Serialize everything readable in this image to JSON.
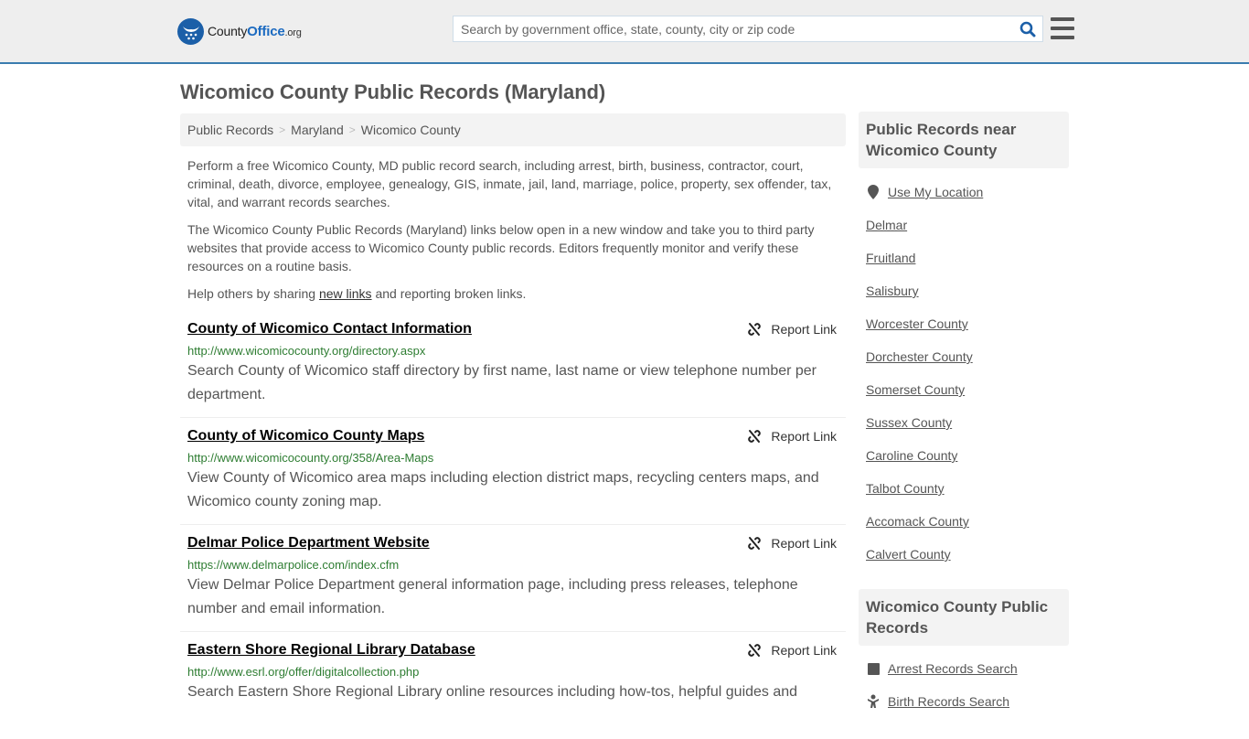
{
  "header": {
    "logo": {
      "name": "County",
      "highlight": "Office",
      "tld": ".org"
    },
    "search": {
      "placeholder": "Search by government office, state, county, city or zip code",
      "value": ""
    },
    "colors": {
      "brand": "#1b5fa8",
      "accent_bar": "#3a7caf"
    }
  },
  "page": {
    "title": "Wicomico County Public Records (Maryland)",
    "breadcrumb": [
      "Public Records",
      "Maryland",
      "Wicomico County"
    ],
    "intro": {
      "p1": "Perform a free Wicomico County, MD public record search, including arrest, birth, business, contractor, court, criminal, death, divorce, employee, genealogy, GIS, inmate, jail, land, marriage, police, property, sex offender, tax, vital, and warrant records searches.",
      "p2": "The Wicomico County Public Records (Maryland) links below open in a new window and take you to third party websites that provide access to Wicomico County public records. Editors frequently monitor and verify these resources on a routine basis.",
      "p3_before": "Help others by sharing ",
      "p3_link": "new links",
      "p3_after": " and reporting broken links."
    },
    "report_label": "Report Link",
    "records": [
      {
        "title": "County of Wicomico Contact Information",
        "url": "http://www.wicomicocounty.org/directory.aspx",
        "desc": "Search County of Wicomico staff directory by first name, last name or view telephone number per department."
      },
      {
        "title": "County of Wicomico County Maps",
        "url": "http://www.wicomicocounty.org/358/Area-Maps",
        "desc": "View County of Wicomico area maps including election district maps, recycling centers maps, and Wicomico county zoning map."
      },
      {
        "title": "Delmar Police Department Website",
        "url": "https://www.delmarpolice.com/index.cfm",
        "desc": "View Delmar Police Department general information page, including press releases, telephone number and email information."
      },
      {
        "title": "Eastern Shore Regional Library Database",
        "url": "http://www.esrl.org/offer/digitalcollection.php",
        "desc": "Search Eastern Shore Regional Library online resources including how-tos, helpful guides and"
      }
    ]
  },
  "sidebar": {
    "nearby": {
      "heading": "Public Records near Wicomico County",
      "use_location": "Use My Location",
      "places": [
        "Delmar",
        "Fruitland",
        "Salisbury",
        "Worcester County",
        "Dorchester County",
        "Somerset County",
        "Sussex County",
        "Caroline County",
        "Talbot County",
        "Accomack County",
        "Calvert County"
      ]
    },
    "county_records": {
      "heading": "Wicomico County Public Records",
      "items": [
        {
          "label": "Arrest Records Search",
          "icon": "square-icon"
        },
        {
          "label": "Birth Records Search",
          "icon": "baby-icon"
        }
      ]
    }
  }
}
